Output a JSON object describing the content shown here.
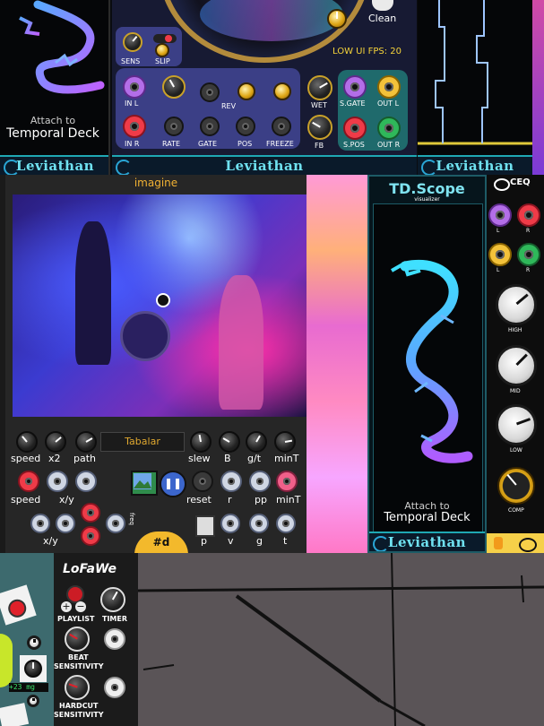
{
  "top": {
    "dragon_left": {
      "caption_small": "Attach to",
      "caption_big": "Temporal Deck",
      "brand": "Leviathan"
    },
    "reverb": {
      "clean_label": "Clean",
      "fps_text": "LOW UI FPS: 20",
      "knob_labels": {
        "sens": "SENS",
        "slip": "SLIP",
        "wet": "WET",
        "fb": "FB"
      },
      "jack_labels": {
        "in_l": "IN L",
        "in_r": "IN R",
        "rate": "RATE",
        "gate": "GATE",
        "pos": "POS",
        "freeze": "FREEZE",
        "rev": "REV",
        "s_gate": "S.GATE",
        "out_l": "OUT L",
        "s_pos": "S.POS",
        "out_r": "OUT R"
      },
      "brand": "Leviathan"
    },
    "scope_right": {
      "brand": "Leviathan"
    }
  },
  "imagine": {
    "title": "imagine",
    "display_text": "Tabalar",
    "row1_labels": [
      "speed",
      "x2",
      "path",
      "slew",
      "B",
      "g/t",
      "minT"
    ],
    "row2_labels": [
      "speed",
      "x/y",
      "reset",
      "r",
      "pp",
      "minT"
    ],
    "row3_labels": [
      "x/y",
      "p",
      "v",
      "g",
      "t"
    ],
    "badge": "#d",
    "vertical_label": "freq"
  },
  "tdscope": {
    "title": "TD.Scope",
    "subtitle": "visualizer",
    "caption_small": "Attach to",
    "caption_big": "Temporal Deck",
    "brand": "Leviathan"
  },
  "ceq": {
    "title": "CEQ",
    "jack_labels": [
      "L",
      "R",
      "L",
      "R"
    ],
    "knob_labels": [
      "HIGH",
      "MID",
      "LOW",
      "COMP"
    ]
  },
  "lofade": {
    "title": "LoFaWe",
    "labels": {
      "playlist": "PLAYLIST",
      "timer": "TIMER",
      "beat": "BEAT",
      "beat2": "SENSITIVITY",
      "hardcut": "HARDCUT",
      "hardcut2": "SENSITIVITY"
    },
    "plus": "+",
    "minus": "−"
  },
  "bottom_left": {
    "readout": "+23 mg"
  },
  "colors": {
    "accent_cyan": "#1fa8b3",
    "brand_text": "#6fe1f0",
    "panel_dark": "#050608"
  }
}
